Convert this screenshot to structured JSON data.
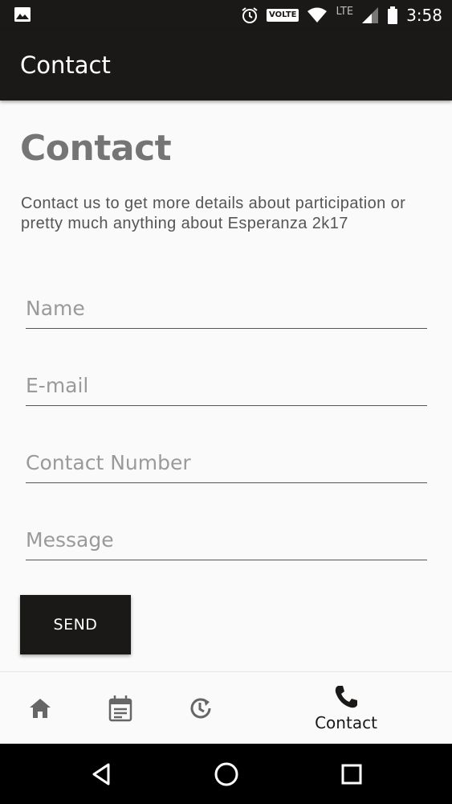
{
  "status_bar": {
    "time": "3:58",
    "volte": "VOLTE",
    "network": "LTE",
    "icons": [
      "image-icon",
      "alarm-icon",
      "volte-icon",
      "wifi-icon",
      "signal-icon",
      "battery-icon"
    ]
  },
  "app_bar": {
    "title": "Contact"
  },
  "main": {
    "heading": "Contact",
    "description": "Contact us to get more details about participation or pretty much anything about Esperanza 2k17",
    "fields": {
      "name_placeholder": "Name",
      "email_placeholder": "E-mail",
      "phone_placeholder": "Contact Number",
      "message_placeholder": "Message"
    },
    "send_label": "SEND"
  },
  "bottom_nav": {
    "items": [
      {
        "icon": "home-icon",
        "label": ""
      },
      {
        "icon": "calendar-icon",
        "label": ""
      },
      {
        "icon": "history-icon",
        "label": ""
      },
      {
        "icon": "phone-icon",
        "label": "Contact",
        "selected": true
      }
    ]
  },
  "colors": {
    "primary": "#1b1918",
    "background": "#fafafa",
    "heading_text": "#757575",
    "body_text": "#555555",
    "placeholder_text": "#9a9a9a"
  }
}
